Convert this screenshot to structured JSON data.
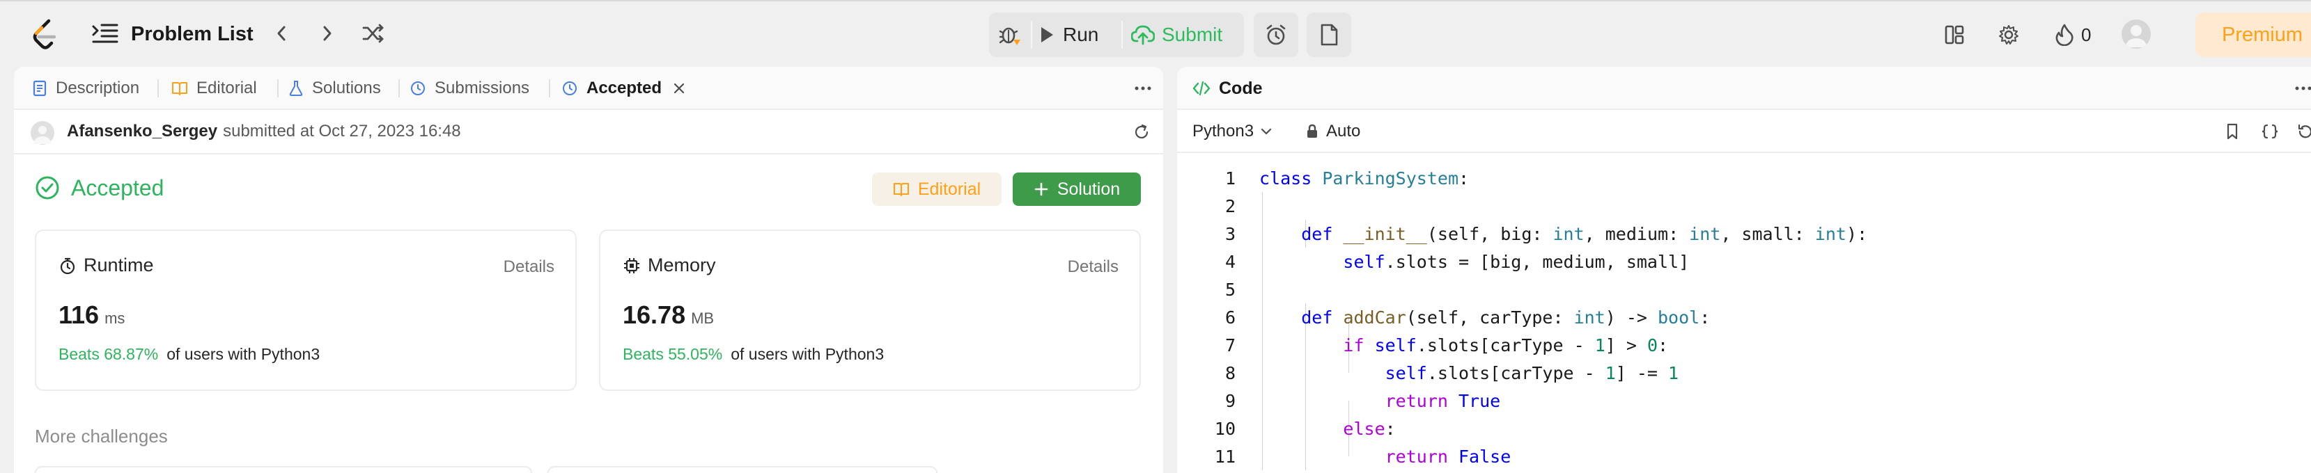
{
  "topbar": {
    "problem_list_label": "Problem List",
    "run_label": "Run",
    "submit_label": "Submit",
    "streak_count": "0",
    "premium_label": "Premium"
  },
  "left_tabs": {
    "description": "Description",
    "editorial": "Editorial",
    "solutions": "Solutions",
    "submissions": "Submissions",
    "accepted": "Accepted"
  },
  "submission": {
    "username": "Afansenko_Sergey",
    "submitted_text": "submitted at Oct 27, 2023 16:48",
    "status": "Accepted",
    "editorial_btn": "Editorial",
    "solution_btn": "Solution"
  },
  "runtime": {
    "title": "Runtime",
    "details": "Details",
    "value": "116",
    "unit": "ms",
    "beats": "Beats 68.87%",
    "beats_suffix": "of users with Python3"
  },
  "memory": {
    "title": "Memory",
    "details": "Details",
    "value": "16.78",
    "unit": "MB",
    "beats": "Beats 55.05%",
    "beats_suffix": "of users with Python3"
  },
  "more_challenges": "More challenges",
  "code_panel": {
    "tab_label": "Code",
    "language": "Python3",
    "mode": "Auto"
  },
  "code_lines": [
    "class ParkingSystem:",
    "",
    "    def __init__(self, big: int, medium: int, small: int):",
    "        self.slots = [big, medium, small]",
    "",
    "    def addCar(self, carType: int) -> bool:",
    "        if self.slots[carType - 1] > 0:",
    "            self.slots[carType - 1] -= 1",
    "            return True",
    "        else:",
    "            return False"
  ],
  "line_numbers": [
    "1",
    "2",
    "3",
    "4",
    "5",
    "6",
    "7",
    "8",
    "9",
    "10",
    "11"
  ],
  "colors": {
    "accent_green": "#2db55d",
    "submit_green": "#2cbb5d",
    "brand_orange": "#ffa116",
    "solution_bg": "#3e9b4a"
  }
}
